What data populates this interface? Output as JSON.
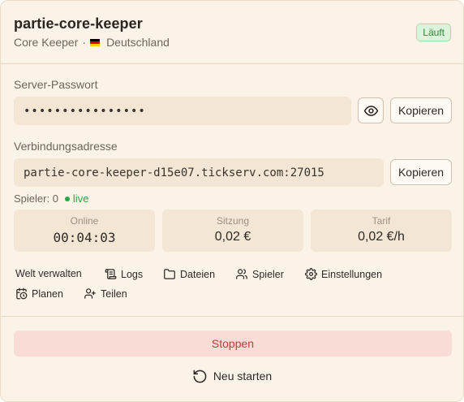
{
  "header": {
    "title": "partie-core-keeper",
    "game": "Core Keeper",
    "separator": "·",
    "region": "Deutschland",
    "status": "Läuft"
  },
  "password": {
    "label": "Server-Passwort",
    "value": "••••••••••••••••",
    "copy_label": "Kopieren"
  },
  "address": {
    "label": "Verbindungsadresse",
    "value": "partie-core-keeper-d15e07.tickserv.com:27015",
    "copy_label": "Kopieren"
  },
  "players": {
    "text": "Spieler: 0",
    "live": "live"
  },
  "stats": [
    {
      "label": "Online",
      "value": "00:04:03"
    },
    {
      "label": "Sitzung",
      "value": "0,02 €"
    },
    {
      "label": "Tarif",
      "value": "0,02 €/h"
    }
  ],
  "actions": {
    "manage_world": "Welt verwalten",
    "logs": "Logs",
    "files": "Dateien",
    "players": "Spieler",
    "settings": "Einstellungen",
    "schedule": "Planen",
    "share": "Teilen"
  },
  "footer": {
    "stop": "Stoppen",
    "restart": "Neu starten"
  },
  "colors": {
    "card_bg": "#fbf3e8",
    "field_bg": "#f3e6d4",
    "status_green": "#2f8a35",
    "live_green": "#27a745",
    "stop_bg": "#f9dcd6",
    "stop_text": "#c63a3a"
  },
  "icons": {
    "region_flag": "flag-germany-icon",
    "show_password": "eye-icon",
    "logs": "scroll-icon",
    "files": "folder-icon",
    "players": "users-icon",
    "settings": "gear-icon",
    "schedule": "calendar-clock-icon",
    "share": "user-plus-icon",
    "restart": "rotate-ccw-icon"
  }
}
